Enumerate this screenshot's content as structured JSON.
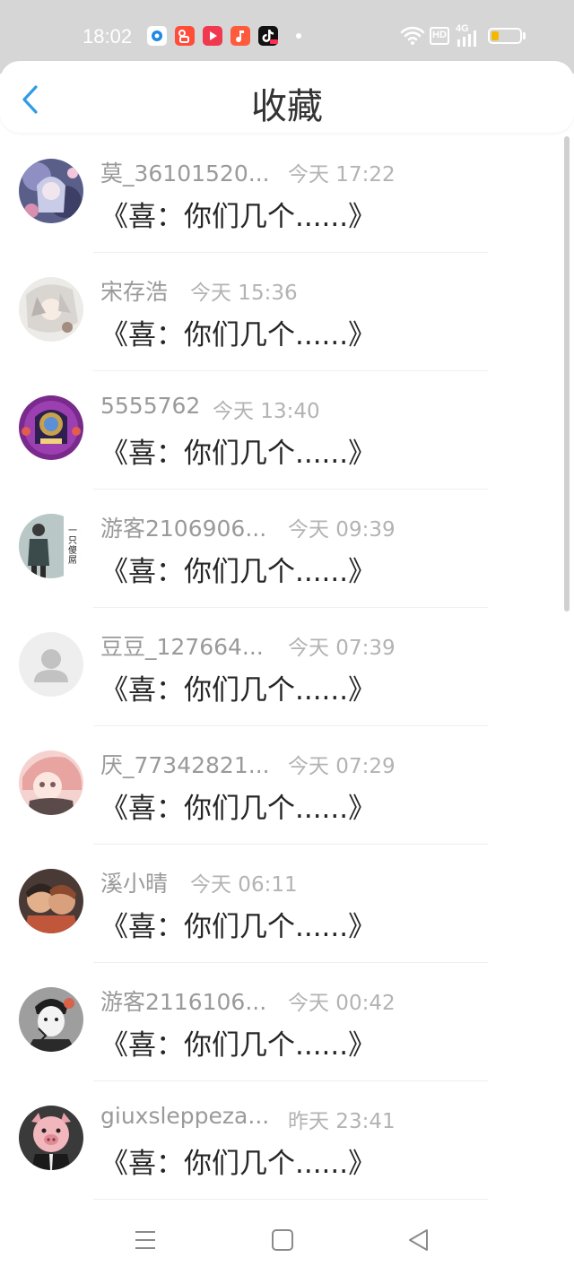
{
  "status_bar": {
    "time": "18:02",
    "apps": [
      {
        "icon": "browser-app-icon",
        "color": "#1e88e5"
      },
      {
        "icon": "kuaishou-app-icon",
        "color": "#ff4d3a"
      },
      {
        "icon": "video-app-icon",
        "color": "#f0394f"
      },
      {
        "icon": "music-app-icon",
        "color": "#ff5a3c"
      },
      {
        "icon": "tiktok-app-icon",
        "color": "#111111"
      }
    ],
    "network": "4G",
    "hd_label": "HD",
    "battery_level": 0.25
  },
  "header": {
    "title": "收藏",
    "back_icon": "chevron-left-icon",
    "accent": "#2f9be8"
  },
  "list": {
    "items": [
      {
        "name": "莫_36101520...",
        "time": "今天 17:22",
        "message": "《喜：你们几个......》",
        "avatar": "anime-girl-avatar"
      },
      {
        "name": "宋存浩",
        "time": "今天 15:36",
        "message": "《喜：你们几个......》",
        "avatar": "anime-white-hair-avatar"
      },
      {
        "name": "5555762",
        "time": "今天 13:40",
        "message": "《喜：你们几个......》",
        "avatar": "game-emblem-avatar"
      },
      {
        "name": "游客2106906...",
        "time": "今天 09:39",
        "message": "《喜：你们几个......》",
        "avatar": "person-photo-avatar"
      },
      {
        "name": "豆豆_127664...",
        "time": "今天 07:39",
        "message": "《喜：你们几个......》",
        "avatar": "default-user-avatar"
      },
      {
        "name": "厌_77342821...",
        "time": "今天 07:29",
        "message": "《喜：你们几个......》",
        "avatar": "pink-hair-avatar"
      },
      {
        "name": "溪小晴",
        "time": "今天 06:11",
        "message": "《喜：你们几个......》",
        "avatar": "couple-illustration-avatar"
      },
      {
        "name": "游客2116106...",
        "time": "今天 00:42",
        "message": "《喜：你们几个......》",
        "avatar": "sketch-portrait-avatar"
      },
      {
        "name": "giuxsleppeza...",
        "time": "昨天 23:41",
        "message": "《喜：你们几个......》",
        "avatar": "pig-avatar"
      }
    ]
  },
  "avatar_text": {
    "person_caption": "一只傻屌"
  },
  "nav_bar": {
    "buttons": [
      "menu-icon",
      "home-square-icon",
      "back-triangle-icon"
    ]
  }
}
